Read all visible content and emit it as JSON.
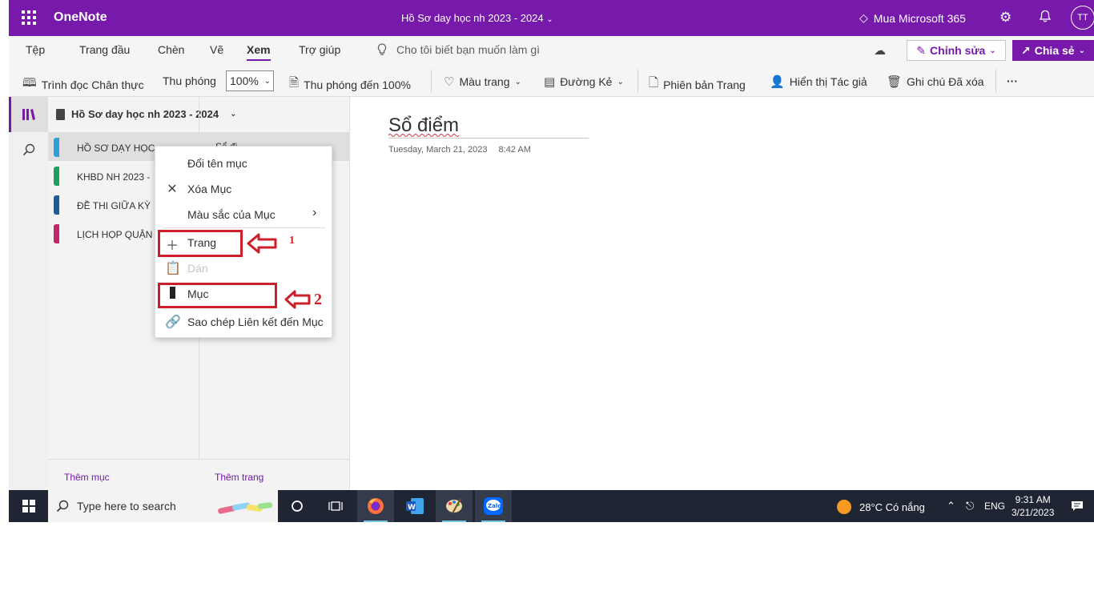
{
  "titlebar": {
    "app_name": "OneNote",
    "document_title": "Hồ Sơ day học nh 2023 - 2024",
    "buy_label": "Mua Microsoft 365",
    "avatar_initials": "TT"
  },
  "tabs": [
    {
      "label": "Tệp"
    },
    {
      "label": "Trang đầu"
    },
    {
      "label": "Chèn"
    },
    {
      "label": "Vẽ"
    },
    {
      "label": "Xem",
      "active": true
    },
    {
      "label": "Trợ giúp"
    }
  ],
  "tell_me_placeholder": "Cho tôi biết bạn muốn làm gì",
  "edit_button": "Chỉnh sửa",
  "share_button": "Chia sẻ",
  "ribbon": {
    "immersive_reader": "Trình đọc Chân thực",
    "zoom_label": "Thu phóng",
    "zoom_value": "100%",
    "zoom_100": "Thu phóng đến 100%",
    "page_color": "Màu trang",
    "rule_lines": "Đường Kẻ",
    "page_versions": "Phiên bản Trang",
    "show_authors": "Hiển thị Tác giả",
    "deleted_notes": "Ghi chú Đã xóa",
    "more": "···"
  },
  "notebook": {
    "name": "Hồ Sơ day học nh 2023 - 2024",
    "sections": [
      {
        "label": "HỒ SƠ DẠY HỌC",
        "color": "#2e9fd8",
        "selected": true
      },
      {
        "label": "KHBD NH 2023 -",
        "color": "#1f9f5e"
      },
      {
        "label": "ĐỀ THI GIỮA KỲ",
        "color": "#1d5c9b"
      },
      {
        "label": "LỊCH HỌP QUẬN",
        "color": "#c0266b"
      }
    ],
    "selected_page_partial": "Sổ đi",
    "add_section": "Thêm mục",
    "add_page": "Thêm trang"
  },
  "page": {
    "title": "Sổ điểm",
    "date": "Tuesday, March 21, 2023",
    "time": "8:42 AM"
  },
  "context_menu": {
    "items": [
      {
        "label": "Đổi tên mục",
        "icon": "none"
      },
      {
        "label": "Xóa Mục",
        "icon": "close-icon"
      },
      {
        "label": "Màu sắc của Mục",
        "icon": "none",
        "submenu": true
      },
      {
        "label": "Trang",
        "icon": "plus-icon"
      },
      {
        "label": "Dán",
        "icon": "paste-icon",
        "disabled": true
      },
      {
        "label": "Mục",
        "icon": "section-icon"
      },
      {
        "label": "Sao chép Liên kết đến Mục",
        "icon": "link-icon"
      }
    ]
  },
  "annotations": {
    "callout_1": "1",
    "callout_2": "2",
    "highlight_color": "#cc1f2a"
  },
  "taskbar": {
    "search_placeholder": "Type here to search",
    "weather": "28°C  Có nắng",
    "language": "ENG",
    "time": "9:31 AM",
    "date": "3/21/2023"
  },
  "colors": {
    "brand": "#7719aa",
    "taskbar": "#1f2532"
  }
}
